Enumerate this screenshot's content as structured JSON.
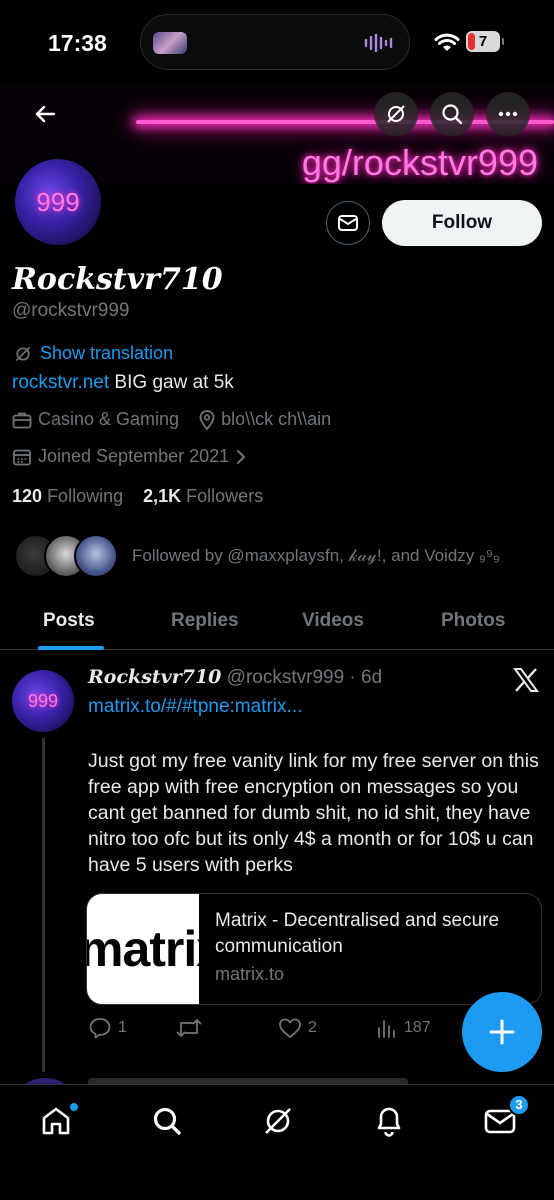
{
  "status": {
    "time": "17:38",
    "battery": "7"
  },
  "banner": {
    "text": "gg/rockstvr999"
  },
  "profile": {
    "avatar_text": "999",
    "display_name": "Rockstvr710",
    "handle": "@rockstvr999",
    "show_translation": "Show translation",
    "bio_link": "rockstvr.net",
    "bio_text": " BIG gaw at 5k",
    "category": "Casino & Gaming",
    "location": "blo\\\\ck ch\\\\ain",
    "joined": "Joined September 2021",
    "following_count": "120",
    "following_label": "Following",
    "followers_count": "2,1K",
    "followers_label": "Followers",
    "followed_by": "Followed by @maxxplaysfn, 𝓀𝒶𝓎!, and Voidzy ₉⁹₉",
    "follow_label": "Follow"
  },
  "tabs": [
    {
      "label": "Posts",
      "active": true
    },
    {
      "label": "Replies",
      "active": false
    },
    {
      "label": "Videos",
      "active": false
    },
    {
      "label": "Photos",
      "active": false
    }
  ],
  "post": {
    "avatar_text": "999",
    "author_name": "Rockstvr710",
    "author_meta": " @rockstvr999 · 6d",
    "link": "matrix.to/#/#tpne:matrix...",
    "text": "Just got my free vanity link for my free server on this free app with free encryption on messages so you cant get banned for dumb shit, no id shit, they have nitro too ofc but its only 4$ a month or for 10$ u can have 5 users with perks",
    "card": {
      "image_text": "matrix",
      "title": "Matrix - Decentralised and secure communication",
      "domain": "matrix.to"
    },
    "replies": "1",
    "reposts": "",
    "likes": "2",
    "views": "187"
  },
  "bottom_nav": {
    "messages_badge": "3"
  },
  "colors": {
    "accent": "#1d9bf0",
    "neon": "#ff5ad0",
    "background": "#000000"
  }
}
